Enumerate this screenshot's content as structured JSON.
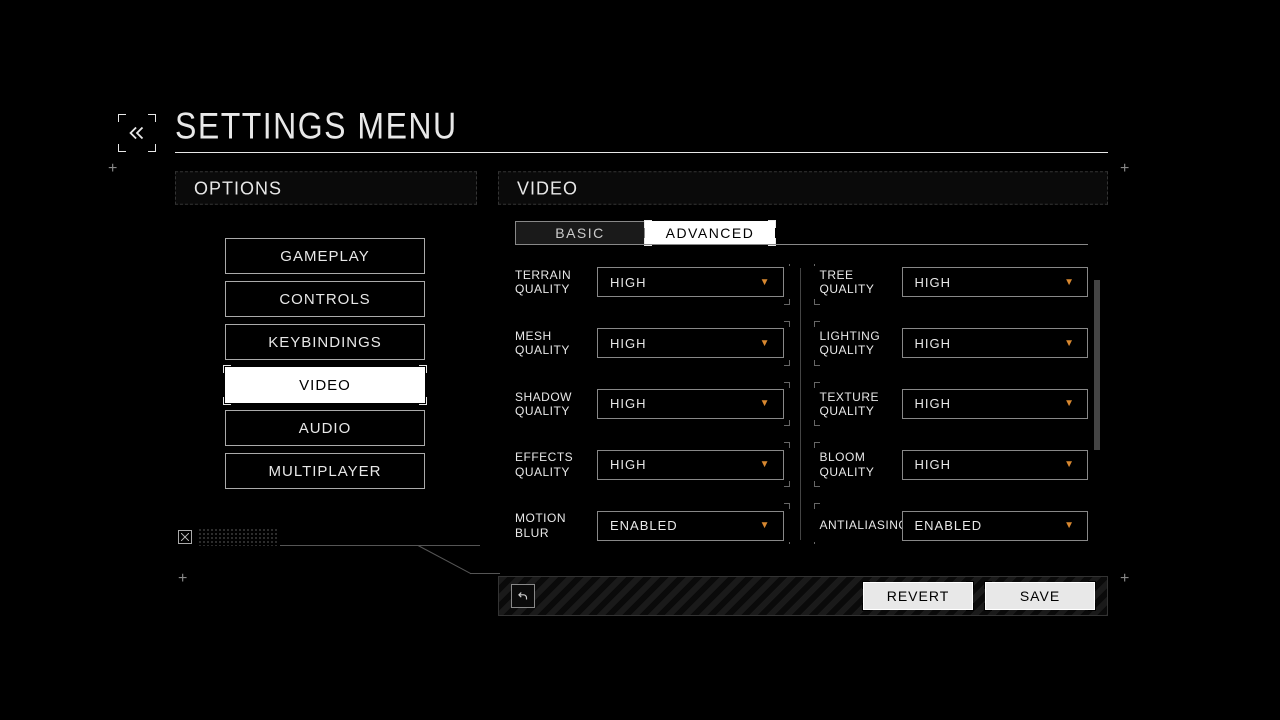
{
  "title": "SETTINGS MENU",
  "sidebar": {
    "header": "OPTIONS",
    "items": [
      {
        "label": "GAMEPLAY"
      },
      {
        "label": "CONTROLS"
      },
      {
        "label": "KEYBINDINGS"
      },
      {
        "label": "VIDEO",
        "active": true
      },
      {
        "label": "AUDIO"
      },
      {
        "label": "MULTIPLAYER"
      }
    ]
  },
  "panel": {
    "header": "VIDEO",
    "tabs": [
      {
        "label": "BASIC"
      },
      {
        "label": "ADVANCED",
        "active": true
      }
    ]
  },
  "settings": {
    "left": [
      {
        "label": "TERRAIN QUALITY",
        "value": "HIGH"
      },
      {
        "label": "MESH QUALITY",
        "value": "HIGH"
      },
      {
        "label": "SHADOW QUALITY",
        "value": "HIGH"
      },
      {
        "label": "EFFECTS QUALITY",
        "value": "HIGH"
      },
      {
        "label": "MOTION BLUR",
        "value": "ENABLED"
      }
    ],
    "right": [
      {
        "label": "TREE QUALITY",
        "value": "HIGH"
      },
      {
        "label": "LIGHTING QUALITY",
        "value": "HIGH"
      },
      {
        "label": "TEXTURE QUALITY",
        "value": "HIGH"
      },
      {
        "label": "BLOOM QUALITY",
        "value": "HIGH"
      },
      {
        "label": "ANTIALIASING",
        "value": "ENABLED"
      }
    ]
  },
  "footer": {
    "revert": "REVERT",
    "save": "SAVE"
  }
}
